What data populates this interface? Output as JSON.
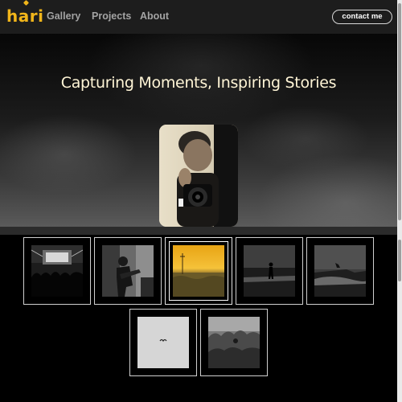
{
  "nav": {
    "logo": "hari",
    "links": [
      "Gallery",
      "Projects",
      "About"
    ],
    "contact_label": "contact me"
  },
  "hero": {
    "title": "Capturing Moments, Inspiring Stories"
  },
  "gallery": {
    "items": [
      {
        "name": "concert-photo"
      },
      {
        "name": "guitarist-photo"
      },
      {
        "name": "sunset-field-photo",
        "selected": true
      },
      {
        "name": "beach-silhouette-photo"
      },
      {
        "name": "shore-surfer-photo"
      },
      {
        "name": "bird-sky-photo"
      },
      {
        "name": "bushes-photo"
      }
    ]
  },
  "colors": {
    "accent": "#f1b51a",
    "nav_bg": "#1d1d1d",
    "page_bg": "#000000",
    "title": "#fff5d6"
  }
}
